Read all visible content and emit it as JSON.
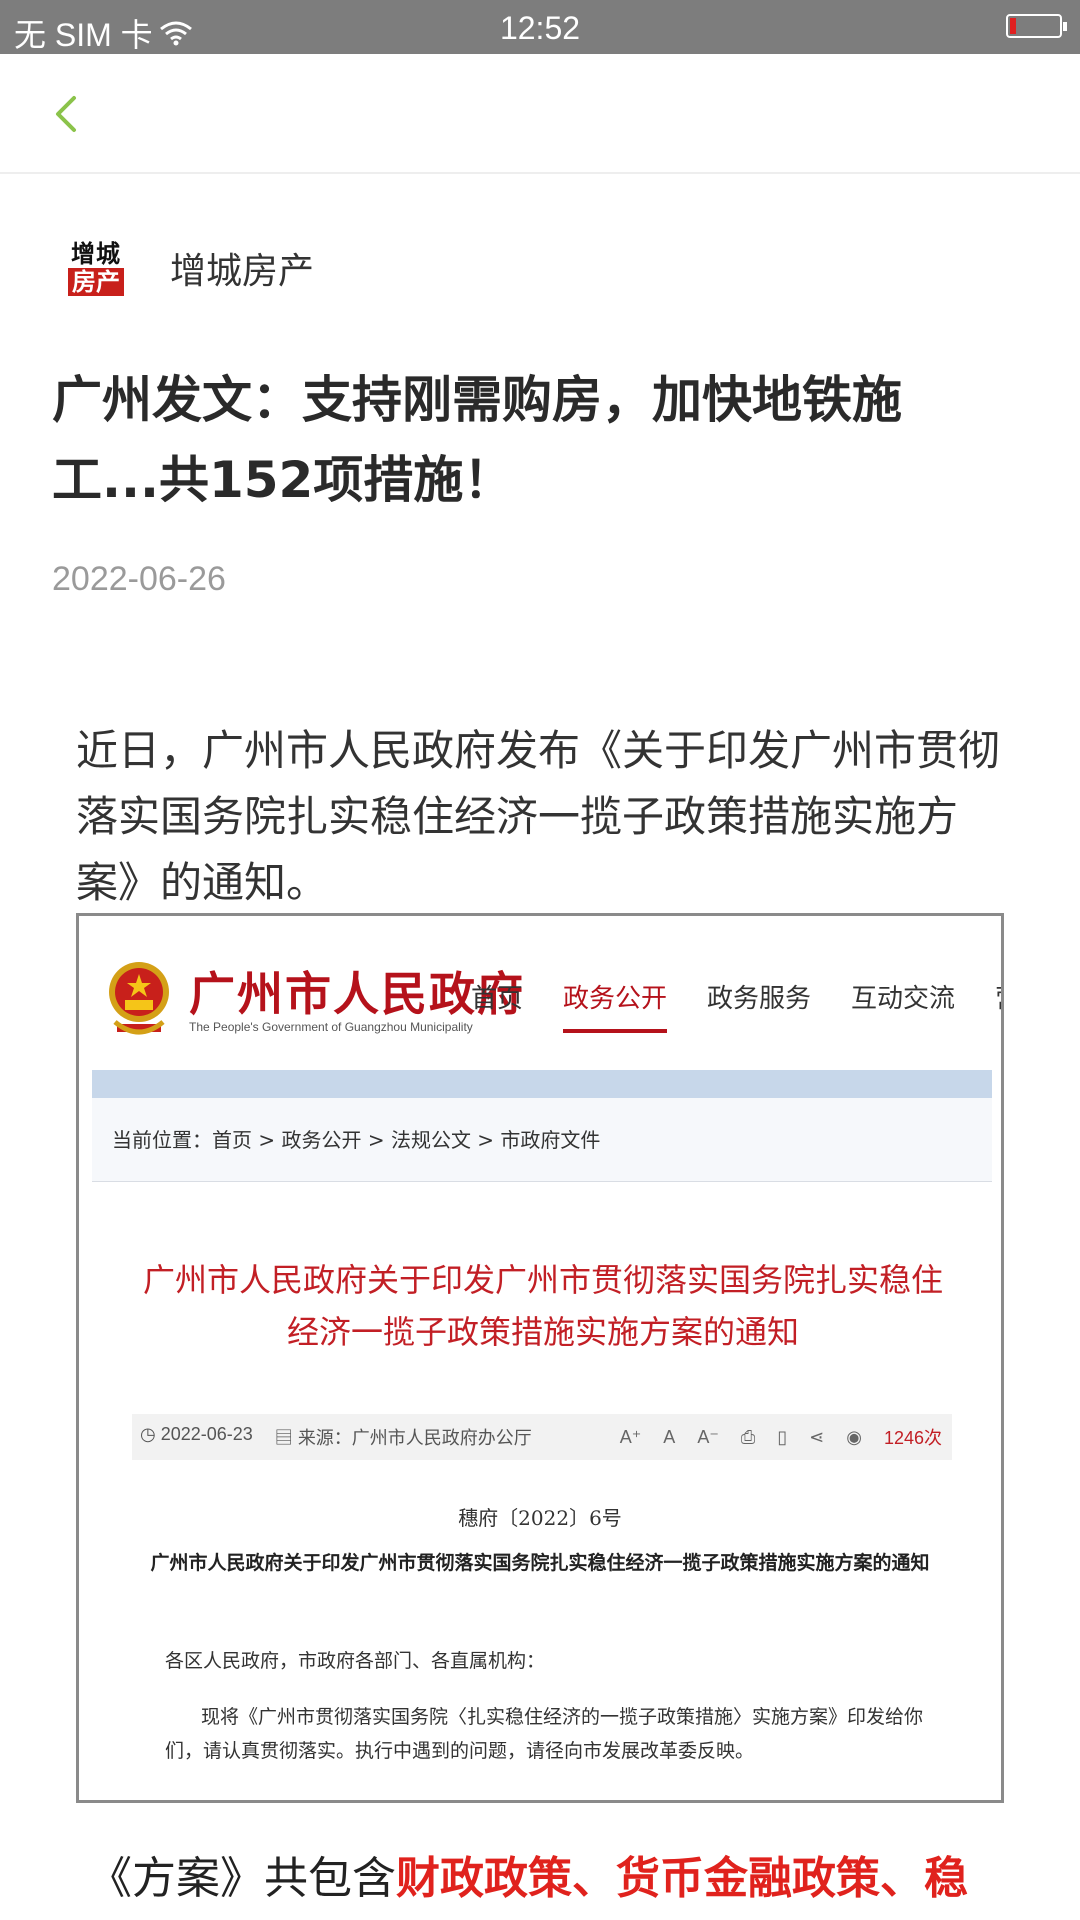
{
  "status_bar": {
    "carrier": "无 SIM 卡",
    "time": "12:52",
    "battery_level": 0.12
  },
  "author": {
    "logo_line1": "增城",
    "logo_line2": "房产",
    "name": "增城房产"
  },
  "article": {
    "title": "广州发文：支持刚需购房，加快地铁施工...共152项措施！",
    "date": "2022-06-26",
    "paragraph1": "近日，广州市人民政府发布《关于印发广州市贯彻落实国务院扎实稳住经济一揽子政策措施实施方案》的通知。",
    "paragraph2_prefix": "《方案》共包含",
    "paragraph2_highlight": "财政政策、货币金融政策、稳"
  },
  "embedded_page": {
    "site_name": "广州市人民政府",
    "site_name_en": "The People's Government of Guangzhou Municipality",
    "nav": [
      "首页",
      "政务公开",
      "政务服务",
      "互动交流",
      "营商环境"
    ],
    "active_nav": "政务公开",
    "breadcrumb": "当前位置：首页 > 政务公开 > 法规公文 > 市政府文件",
    "doc_title": "广州市人民政府关于印发广州市贯彻落实国务院扎实稳住经济一揽子政策措施实施方案的通知",
    "meta_date": "2022-06-23",
    "meta_source": "来源：广州市人民政府办公厅",
    "meta_tools": [
      "A⁺",
      "A",
      "A⁻"
    ],
    "views": "1246次",
    "doc_number": "穗府〔2022〕6号",
    "doc_heading": "广州市人民政府关于印发广州市贯彻落实国务院扎实稳住经济一揽子政策措施实施方案的通知",
    "salutation": "各区人民政府，市政府各部门、各直属机构：",
    "body": "现将《广州市贯彻落实国务院〈扎实稳住经济的一揽子政策措施〉实施方案》印发给你们，请认真贯彻落实。执行中遇到的问题，请径向市发展改革委反映。"
  },
  "colors": {
    "accent_green": "#8bc34a",
    "gov_red": "#b5121b",
    "highlight_red": "#e0221d"
  }
}
